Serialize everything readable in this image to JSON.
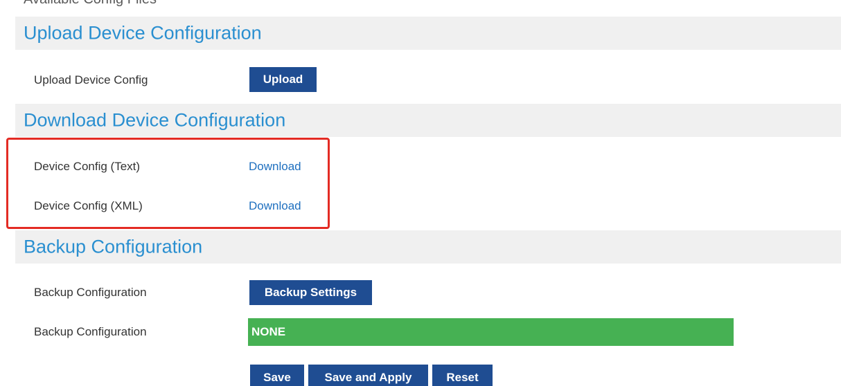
{
  "previous_section": {
    "title": "Available Config Files"
  },
  "upload_section": {
    "title": "Upload Device Configuration",
    "row_label": "Upload Device Config",
    "button_label": "Upload"
  },
  "download_section": {
    "title": "Download Device Configuration",
    "rows": [
      {
        "label": "Device Config (Text)",
        "link": "Download"
      },
      {
        "label": "Device Config (XML)",
        "link": "Download"
      }
    ]
  },
  "backup_section": {
    "title": "Backup Configuration",
    "rows": [
      {
        "label": "Backup Configuration",
        "button_label": "Backup Settings"
      },
      {
        "label": "Backup Configuration",
        "status": "NONE"
      }
    ]
  },
  "footer": {
    "save_label": "Save",
    "save_apply_label": "Save and Apply",
    "reset_label": "Reset"
  },
  "colors": {
    "section_title": "#2a8fd0",
    "button_bg": "#1f4d92",
    "status_bg": "#46b153",
    "highlight_border": "#e32b24",
    "section_bar_bg": "#f0f0f0"
  }
}
